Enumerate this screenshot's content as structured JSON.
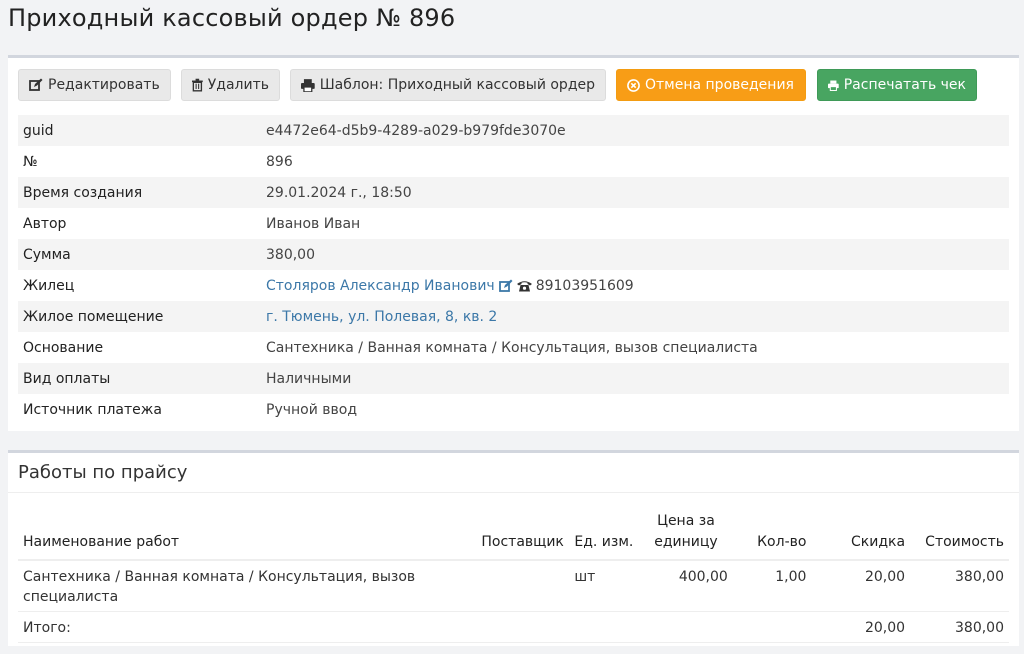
{
  "page": {
    "title": "Приходный кассовый ордер № 896"
  },
  "toolbar": {
    "edit_label": "Редактировать",
    "delete_label": "Удалить",
    "template_label": "Шаблон: Приходный кассовый ордер",
    "cancel_label": "Отмена проведения",
    "print_label": "Распечатать чек"
  },
  "colors": {
    "warning": "#f89d16",
    "success": "#48a561",
    "link": "#3c78a8"
  },
  "details": {
    "guid_label": "guid",
    "guid_value": "e4472e64-d5b9-4289-a029-b979fde3070e",
    "number_label": "№",
    "number_value": "896",
    "created_label": "Время создания",
    "created_value": "29.01.2024 г., 18:50",
    "author_label": "Автор",
    "author_value": "Иванов Иван",
    "sum_label": "Сумма",
    "sum_value": "380,00",
    "tenant_label": "Жилец",
    "tenant_value": "Столяров Александр Иванович",
    "tenant_phone": "89103951609",
    "premises_label": "Жилое помещение",
    "premises_value": "г. Тюмень, ул. Полевая, 8, кв. 2",
    "basis_label": "Основание",
    "basis_value": "Сантехника / Ванная комната / Консультация, вызов специалиста",
    "payment_type_label": "Вид оплаты",
    "payment_type_value": "Наличными",
    "source_label": "Источник платежа",
    "source_value": "Ручной ввод"
  },
  "works": {
    "title": "Работы по прайсу",
    "columns": {
      "name": "Наименование работ",
      "supplier": "Поставщик",
      "unit": "Ед. изм.",
      "price_l1": "Цена за",
      "price_l2": "единицу",
      "qty": "Кол-во",
      "discount": "Скидка",
      "cost": "Стоимость"
    },
    "rows": [
      {
        "name": "Сантехника / Ванная комната / Консультация, вызов специалиста",
        "supplier": "",
        "unit": "шт",
        "price": "400,00",
        "qty": "1,00",
        "discount": "20,00",
        "cost": "380,00"
      }
    ],
    "total": {
      "label": "Итого:",
      "discount": "20,00",
      "cost": "380,00"
    }
  }
}
